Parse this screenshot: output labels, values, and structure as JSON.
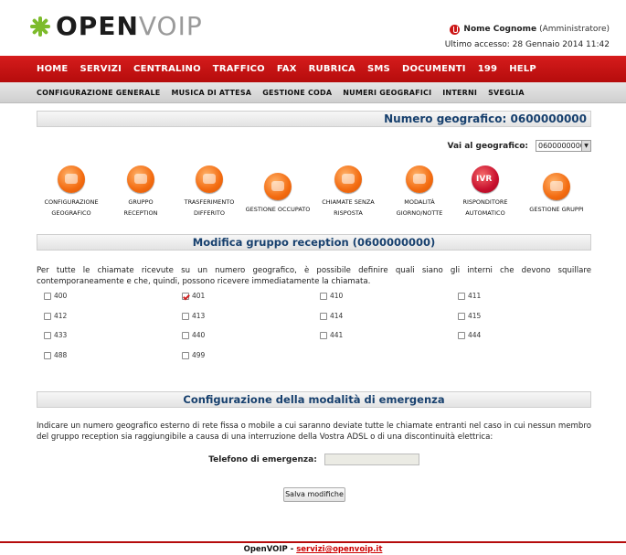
{
  "header": {
    "logo_open": "OPEN",
    "logo_voip": "VOIP",
    "user_name": "Nome Cognome",
    "user_role": "(Amministratore)",
    "last_access": "Ultimo accesso: 28 Gennaio 2014 11:42"
  },
  "mainnav": [
    "HOME",
    "SERVIZI",
    "CENTRALINO",
    "TRAFFICO",
    "FAX",
    "RUBRICA",
    "SMS",
    "DOCUMENTI",
    "199",
    "HELP"
  ],
  "subnav": [
    "CONFIGURAZIONE GENERALE",
    "MUSICA DI ATTESA",
    "GESTIONE CODA",
    "NUMERI GEOGRAFICI",
    "INTERNI",
    "SVEGLIA"
  ],
  "geo": {
    "title": "Numero geografico: 0600000000",
    "goto_label": "Vai al geografico:",
    "goto_value": "0600000000"
  },
  "icons": [
    {
      "line1": "CONFIGURAZIONE",
      "line2": "GEOGRAFICO"
    },
    {
      "line1": "GRUPPO",
      "line2": "RECEPTION"
    },
    {
      "line1": "TRASFERIMENTO",
      "line2": "DIFFERITO"
    },
    {
      "line1": "GESTIONE OCCUPATO",
      "line2": ""
    },
    {
      "line1": "CHIAMATE SENZA",
      "line2": "RISPOSTA"
    },
    {
      "line1": "MODALITÀ",
      "line2": "GIORNO/NOTTE"
    },
    {
      "line1": "RISPONDITORE",
      "line2": "AUTOMATICO"
    },
    {
      "line1": "GESTIONE GRUPPI",
      "line2": ""
    }
  ],
  "reception": {
    "title": "Modifica gruppo reception (0600000000)",
    "description": "Per tutte le chiamate ricevute su un numero geografico, è possibile definire quali siano gli interni che devono squillare contemporaneamente e che, quindi, possono ricevere immediatamente la chiamata.",
    "extensions": [
      {
        "num": "400",
        "checked": false
      },
      {
        "num": "401",
        "checked": true
      },
      {
        "num": "410",
        "checked": false
      },
      {
        "num": "411",
        "checked": false
      },
      {
        "num": "412",
        "checked": false
      },
      {
        "num": "413",
        "checked": false
      },
      {
        "num": "414",
        "checked": false
      },
      {
        "num": "415",
        "checked": false
      },
      {
        "num": "433",
        "checked": false
      },
      {
        "num": "440",
        "checked": false
      },
      {
        "num": "441",
        "checked": false
      },
      {
        "num": "444",
        "checked": false
      },
      {
        "num": "488",
        "checked": false
      },
      {
        "num": "499",
        "checked": false
      }
    ]
  },
  "emergency": {
    "title": "Configurazione della modalità di emergenza",
    "description": "Indicare un numero geografico esterno di rete fissa o mobile a cui saranno deviate tutte le chiamate entranti nel caso in cui nessun membro del gruppo reception sia raggiungibile a causa di una interruzione della Vostra ADSL o di una discontinuità elettrica:",
    "phone_label": "Telefono di emergenza:",
    "phone_value": "",
    "save_label": "Salva modifiche"
  },
  "footer": {
    "brand": "OpenVOIP - ",
    "email": "servizi@openvoip.it"
  },
  "colors": {
    "brand_red": "#c8102e",
    "brand_green": "#7dbb2c",
    "title_blue": "#17406e"
  }
}
